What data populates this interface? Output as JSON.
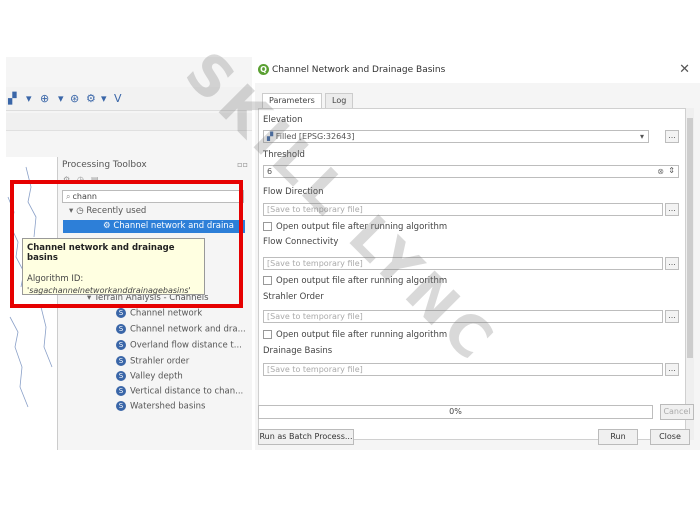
{
  "left_window": {
    "processing_toolbox": {
      "title": "Processing Toolbox",
      "search_value": "chann",
      "recently_used_label": "Recently used",
      "highlighted_item": "Channel network and draina",
      "group_label": "Terrain Analysis - Channels",
      "algorithms": [
        "Channel network",
        "Channel network and dra...",
        "Overland flow distance t...",
        "Strahler order",
        "Valley depth",
        "Vertical distance to chan...",
        "Watershed basins"
      ]
    },
    "tooltip": {
      "title": "Channel network and drainage basins",
      "id_label": "Algorithm ID:",
      "id_value": "'sagachannelnetworkanddrainagebasins'"
    }
  },
  "dialog": {
    "title": "Channel Network and Drainage Basins",
    "close_glyph": "✕",
    "tabs": [
      "Parameters",
      "Log"
    ],
    "elevation": {
      "label": "Elevation",
      "value": "Filled [EPSG:32643]"
    },
    "threshold": {
      "label": "Threshold",
      "value": "6"
    },
    "flow_direction": {
      "label": "Flow Direction",
      "placeholder": "[Save to temporary file]",
      "open_output": "Open output file after running algorithm"
    },
    "flow_connectivity": {
      "label": "Flow Connectivity",
      "placeholder": "[Save to temporary file]",
      "open_output": "Open output file after running algorithm"
    },
    "strahler_order": {
      "label": "Strahler Order",
      "placeholder": "[Save to temporary file]",
      "open_output": "Open output file after running algorithm"
    },
    "drainage_basins": {
      "label": "Drainage Basins",
      "placeholder": "[Save to temporary file]"
    },
    "dots_label": "...",
    "progress": {
      "text": "0%",
      "value": 0
    },
    "buttons": {
      "cancel": "Cancel",
      "batch": "Run as Batch Process...",
      "run": "Run",
      "close": "Close"
    }
  },
  "watermark": "SKILL LYNC",
  "colors": {
    "highlight_border": "#e60000",
    "selection": "#2d7fd8",
    "tooltip_bg": "#ffffe1"
  }
}
